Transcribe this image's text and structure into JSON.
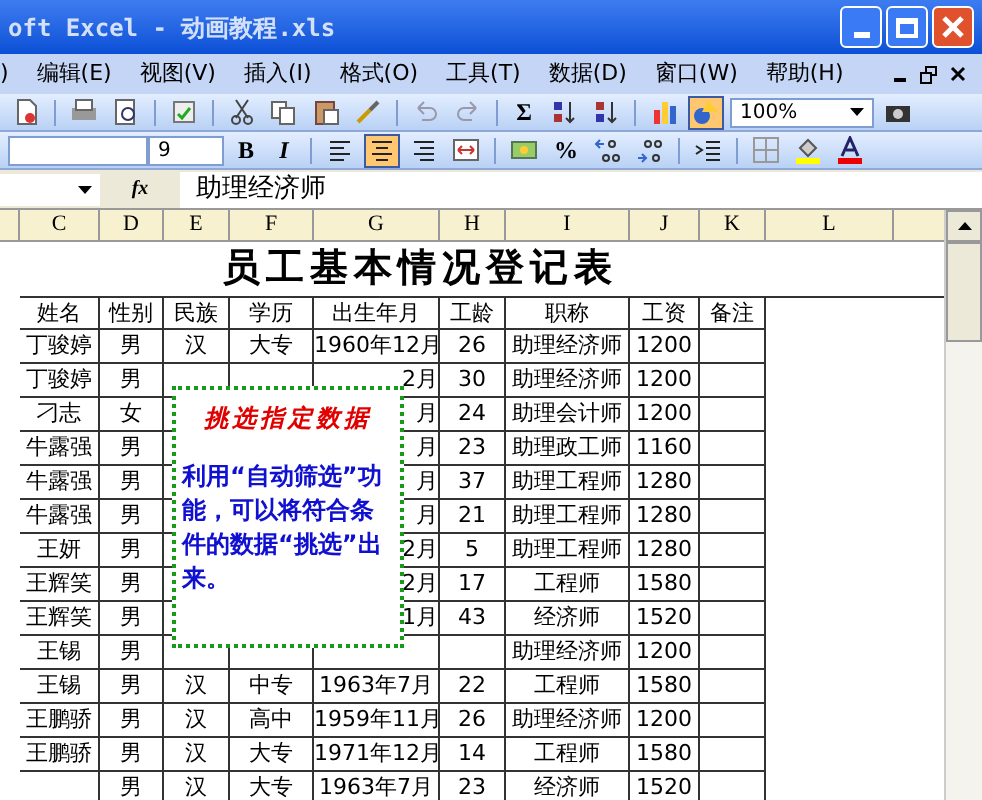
{
  "window": {
    "title": "oft Excel - 动画教程.xls"
  },
  "menu": [
    ")",
    "编辑(E)",
    "视图(V)",
    "插入(I)",
    "格式(O)",
    "工具(T)",
    "数据(D)",
    "窗口(W)",
    "帮助(H)"
  ],
  "standard_toolbar": [
    {
      "kind": "icon",
      "selected": false
    },
    {
      "kind": "sep"
    },
    {
      "kind": "icon",
      "selected": false
    },
    {
      "kind": "icon",
      "selected": false
    },
    {
      "kind": "sep"
    },
    {
      "kind": "icon",
      "selected": false
    },
    {
      "kind": "sep"
    },
    {
      "kind": "icon",
      "selected": false
    },
    {
      "kind": "icon",
      "selected": false
    },
    {
      "kind": "icon",
      "selected": false
    },
    {
      "kind": "icon",
      "selected": false
    },
    {
      "kind": "sep"
    },
    {
      "kind": "icon",
      "selected": false
    },
    {
      "kind": "icon",
      "selected": false
    },
    {
      "kind": "sep"
    },
    {
      "kind": "text",
      "label": "Σ",
      "selected": false
    },
    {
      "kind": "icon",
      "selected": false
    },
    {
      "kind": "icon",
      "selected": false
    },
    {
      "kind": "sep"
    },
    {
      "kind": "icon",
      "selected": false
    },
    {
      "kind": "icon",
      "selected": true
    },
    {
      "kind": "zoom",
      "label": "100%"
    },
    {
      "kind": "icon",
      "selected": false
    }
  ],
  "format_toolbar": [
    {
      "kind": "fontsize",
      "label": "9"
    },
    {
      "kind": "text",
      "label": "B",
      "selected": false
    },
    {
      "kind": "text",
      "label": "I",
      "selected": false
    },
    {
      "kind": "sep"
    },
    {
      "kind": "icon",
      "selected": false
    },
    {
      "kind": "icon",
      "selected": true
    },
    {
      "kind": "icon",
      "selected": false
    },
    {
      "kind": "icon",
      "selected": false
    },
    {
      "kind": "sep"
    },
    {
      "kind": "icon",
      "selected": false
    },
    {
      "kind": "text",
      "label": "%",
      "selected": false
    },
    {
      "kind": "icon",
      "selected": false
    },
    {
      "kind": "icon",
      "selected": false
    },
    {
      "kind": "sep"
    },
    {
      "kind": "icon",
      "selected": false
    },
    {
      "kind": "sep"
    },
    {
      "kind": "icon",
      "selected": false
    },
    {
      "kind": "icon",
      "selected": false
    },
    {
      "kind": "icon",
      "selected": false
    }
  ],
  "formula_bar": {
    "function_label": "fx",
    "value": "助理经济师"
  },
  "columns": [
    "C",
    "D",
    "E",
    "F",
    "G",
    "H",
    "I",
    "J",
    "K",
    "L"
  ],
  "sheet_title": "员工基本情况登记表",
  "headers": [
    "姓名",
    "性别",
    "民族",
    "学历",
    "出生年月",
    "工龄",
    "职称",
    "工资",
    "备注"
  ],
  "rows": [
    [
      "丁骏婷",
      "男",
      "汉",
      "大专",
      "1960年12月",
      "26",
      "助理经济师",
      "1200"
    ],
    [
      "丁骏婷",
      "男",
      null,
      null,
      "2月",
      "30",
      "助理经济师",
      "1200"
    ],
    [
      "刁志",
      "女",
      null,
      null,
      "月",
      "24",
      "助理会计师",
      "1200"
    ],
    [
      "牛露强",
      "男",
      null,
      null,
      "月",
      "23",
      "助理政工师",
      "1160"
    ],
    [
      "牛露强",
      "男",
      null,
      null,
      "月",
      "37",
      "助理工程师",
      "1280"
    ],
    [
      "牛露强",
      "男",
      null,
      null,
      "月",
      "21",
      "助理工程师",
      "1280"
    ],
    [
      "王妍",
      "男",
      null,
      null,
      "2月",
      "5",
      "助理工程师",
      "1280"
    ],
    [
      "王辉笑",
      "男",
      null,
      null,
      "2月",
      "17",
      "工程师",
      "1580"
    ],
    [
      "王辉笑",
      "男",
      null,
      null,
      "1月",
      "43",
      "经济师",
      "1520"
    ],
    [
      "王锡",
      "男",
      null,
      null,
      null,
      null,
      "助理经济师",
      "1200"
    ],
    [
      "王锡",
      "男",
      "汉",
      "中专",
      "1963年7月",
      "22",
      "工程师",
      "1580"
    ],
    [
      "王鹏骄",
      "男",
      "汉",
      "高中",
      "1959年11月",
      "26",
      "助理经济师",
      "1200"
    ],
    [
      "王鹏骄",
      "男",
      "汉",
      "大专",
      "1971年12月",
      "14",
      "工程师",
      "1580"
    ],
    [
      null,
      "男",
      "汉",
      "大专",
      "1963年7月",
      "23",
      "经济师",
      "1520"
    ]
  ],
  "callout": {
    "title": "挑选指定数据",
    "text": "利用“自动筛选”功能，可以将符合条件的数据“挑选”出来。"
  }
}
